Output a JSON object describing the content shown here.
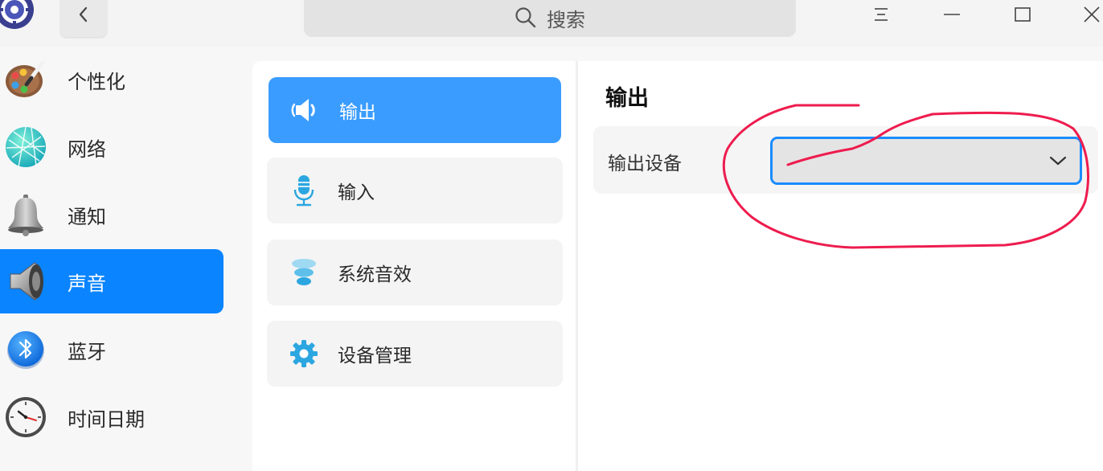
{
  "titlebar": {
    "search_placeholder": "搜索",
    "icons": [
      "app-logo",
      "chevron-left-icon",
      "search-icon",
      "menu-icon",
      "minimize-icon",
      "maximize-icon",
      "close-icon"
    ]
  },
  "sidebar": {
    "items": [
      {
        "label": "个性化",
        "icon": "palette-icon",
        "active": false
      },
      {
        "label": "网络",
        "icon": "network-globe-icon",
        "active": false
      },
      {
        "label": "通知",
        "icon": "bell-icon",
        "active": false
      },
      {
        "label": "声音",
        "icon": "speaker-icon",
        "active": true
      },
      {
        "label": "蓝牙",
        "icon": "bluetooth-icon",
        "active": false
      },
      {
        "label": "时间日期",
        "icon": "clock-icon",
        "active": false
      }
    ]
  },
  "sound_nav": {
    "items": [
      {
        "label": "输出",
        "icon": "speaker-output-icon",
        "active": true
      },
      {
        "label": "输入",
        "icon": "microphone-icon",
        "active": false
      },
      {
        "label": "系统音效",
        "icon": "system-sound-icon",
        "active": false
      },
      {
        "label": "设备管理",
        "icon": "gear-icon",
        "active": false
      }
    ]
  },
  "output": {
    "title": "输出",
    "device_label": "输出设备",
    "device_value": ""
  },
  "colors": {
    "accent": "#0a84ff",
    "annotation": "#ee1c4e"
  }
}
